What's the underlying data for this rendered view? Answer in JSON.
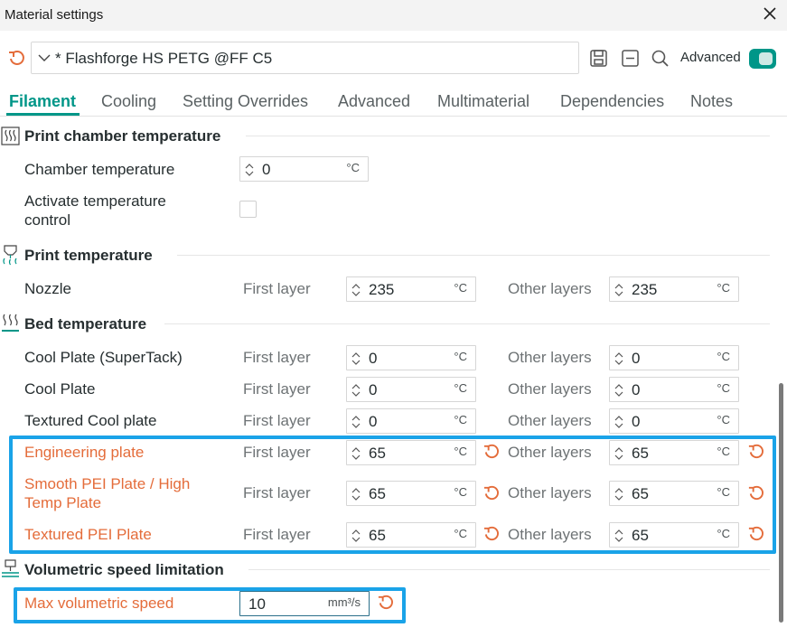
{
  "window": {
    "title": "Material settings"
  },
  "toolbar": {
    "preset_name": "* Flashforge HS PETG @FF C5",
    "advanced_label": "Advanced",
    "advanced_on": true
  },
  "tabs": [
    {
      "label": "Filament",
      "active": true
    },
    {
      "label": "Cooling"
    },
    {
      "label": "Setting Overrides"
    },
    {
      "label": "Advanced"
    },
    {
      "label": "Multimaterial"
    },
    {
      "label": "Dependencies"
    },
    {
      "label": "Notes"
    }
  ],
  "colors": {
    "accent": "#009688",
    "modified": "#e46c3a",
    "highlight": "#1aa3e8"
  },
  "sections": {
    "chamber": {
      "title": "Print chamber temperature",
      "chamber_temp_label": "Chamber temperature",
      "chamber_temp_value": "0",
      "unit": "°C",
      "activate_label_1": "Activate temperature",
      "activate_label_2": "control",
      "activate_checked": false
    },
    "print_temp": {
      "title": "Print temperature",
      "nozzle_label": "Nozzle",
      "first_layer_label": "First layer",
      "other_layers_label": "Other layers",
      "nozzle_first": "235",
      "nozzle_other": "235",
      "unit": "°C"
    },
    "bed_temp": {
      "title": "Bed temperature",
      "first_layer_label": "First layer",
      "other_layers_label": "Other layers",
      "unit": "°C",
      "rows": [
        {
          "label": "Cool Plate (SuperTack)",
          "first": "0",
          "other": "0",
          "modified": false
        },
        {
          "label": "Cool Plate",
          "first": "0",
          "other": "0",
          "modified": false
        },
        {
          "label": "Textured Cool plate",
          "first": "0",
          "other": "0",
          "modified": false
        },
        {
          "label": "Engineering plate",
          "first": "65",
          "other": "65",
          "modified": true
        },
        {
          "label_1": "Smooth PEI Plate / High",
          "label_2": "Temp Plate",
          "first": "65",
          "other": "65",
          "modified": true
        },
        {
          "label": "Textured PEI Plate",
          "first": "65",
          "other": "65",
          "modified": true
        }
      ]
    },
    "volumetric": {
      "title": "Volumetric speed limitation",
      "max_label": "Max volumetric speed",
      "max_value": "10",
      "unit": "mm³/s",
      "modified": true
    }
  }
}
